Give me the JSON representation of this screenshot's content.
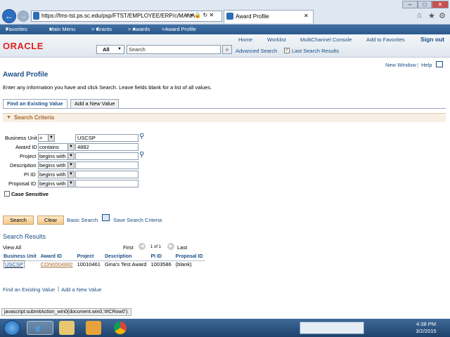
{
  "browser": {
    "url": "https://fms-tst.ps.sc.edu/psp/FTST/EMPLOYEE/ERP/c/MANA",
    "url_controls": "⌕ ▾ 🔒 ↻ ✕",
    "tab_title": "Award Profile",
    "tab_close": "✕",
    "window_controls": [
      "–",
      "□",
      "✕"
    ],
    "chrome_icons": [
      "⌂",
      "★",
      "⚙"
    ],
    "favorites_label": "Favorites",
    "menu_label": "Main Menu",
    "breadcrumbs": [
      "Grants",
      "Awards",
      "Award Profile"
    ]
  },
  "header": {
    "links": [
      "Home",
      "Worklist",
      "MultiChannel Console",
      "Add to Favorites",
      "Sign out"
    ],
    "logo": "ORACLE",
    "search_scope": "All",
    "search_placeholder": "Search",
    "advanced_search": "Advanced Search",
    "last_search_results": "Last Search Results"
  },
  "page": {
    "toplinks": [
      "New Window",
      "Help"
    ],
    "title": "Award Profile",
    "instructions": "Enter any information you have and click Search. Leave fields blank for a list of all values.",
    "tabs": [
      "Find an Existing Value",
      "Add a New Value"
    ],
    "section_title": "Search Criteria"
  },
  "criteria": [
    {
      "label": "Business Unit",
      "op": "=",
      "value": "USCSP",
      "lookup": true
    },
    {
      "label": "Award ID",
      "op": "contains",
      "value": "4882",
      "lookup": false
    },
    {
      "label": "Project",
      "op": "begins with",
      "value": "",
      "lookup": true
    },
    {
      "label": "Description",
      "op": "begins with",
      "value": "",
      "lookup": false
    },
    {
      "label": "PI ID",
      "op": "begins with",
      "value": "",
      "lookup": false
    },
    {
      "label": "Proposal ID",
      "op": "begins with",
      "value": "",
      "lookup": false
    }
  ],
  "case_sensitive": "Case Sensitive",
  "actions": {
    "search": "Search",
    "clear": "Clear",
    "basic_search": "Basic Search",
    "save_criteria": "Save Search Criteria"
  },
  "results": {
    "title": "Search Results",
    "view_all": "View All",
    "first": "First",
    "page_info": "1 of 1",
    "last": "Last",
    "columns": [
      "Business Unit",
      "Award ID",
      "Project",
      "Description",
      "PI ID",
      "Proposal ID"
    ],
    "rows": [
      [
        "USCSP",
        "CON0004882",
        "10010461",
        "Gina's Test Award",
        "1003586",
        "(blank)"
      ]
    ]
  },
  "footer_links": [
    "Find an Existing Value",
    "Add a New Value"
  ],
  "status_bar": "javascript:submitAction_win0(document.win0,'#ICRow0');",
  "taskbar": {
    "time": "4:38 PM",
    "date": "3/2/2015"
  },
  "colors": {
    "brand_red": "#e2211c",
    "link_blue": "#1a4e86",
    "section_bg": "#f7efe4",
    "button_orange": "#f4c98c"
  },
  "icons": [
    "back-arrow-icon",
    "forward-arrow-icon",
    "ie-tab-icon",
    "home-icon",
    "star-icon",
    "gear-icon",
    "lookup-magnifier-icon",
    "save-criteria-icon",
    "windows-start-icon",
    "ie-icon",
    "explorer-folder-icon",
    "media-player-icon",
    "chrome-icon"
  ]
}
